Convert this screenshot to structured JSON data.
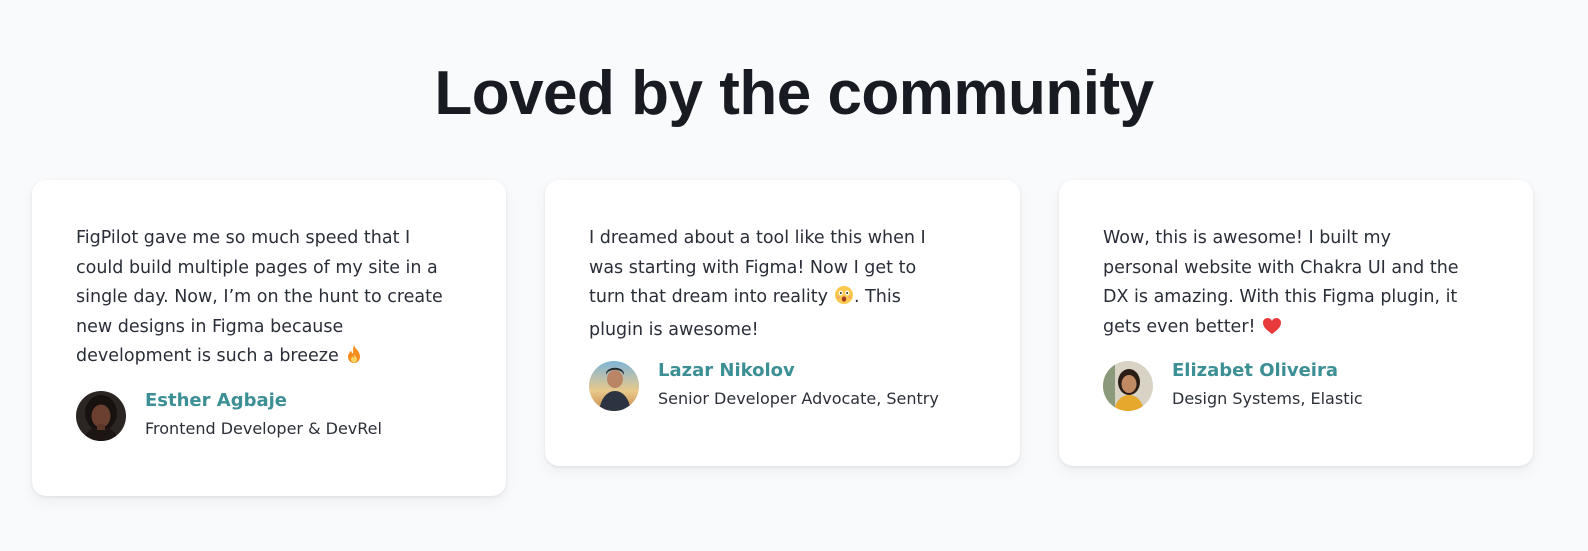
{
  "section": {
    "title": "Loved by the community"
  },
  "colors": {
    "background": "#f9fafc",
    "card": "#ffffff",
    "title": "#181b22",
    "author_name": "#3c8f94",
    "body_text": "#2a2e38"
  },
  "testimonials": [
    {
      "quote": "FigPilot gave me so much speed that I\ncould build multiple pages of my site in a\nsingle day. Now, I’m on the hunt to create\nnew designs in Figma because\ndevelopment is such a breeze",
      "emoji": "fire-icon",
      "name": "Esther Agbaje",
      "role": "Frontend Developer & DevRel",
      "avatar": "avatar-photo"
    },
    {
      "quote": "I dreamed about a tool like this when I\nwas starting with Figma! Now I get to\nturn that dream into reality",
      "quote_tail": ". This\nplugin is awesome!",
      "emoji": "astonished-face-icon",
      "name": "Lazar Nikolov",
      "role": "Senior Developer Advocate, Sentry",
      "avatar": "avatar-photo"
    },
    {
      "quote": "Wow, this is awesome! I built my\npersonal website with Chakra UI and the\nDX is amazing. With this Figma plugin, it\ngets even better!",
      "emoji": "heart-icon",
      "name": "Elizabet Oliveira",
      "role": "Design Systems, Elastic",
      "avatar": "avatar-photo"
    }
  ]
}
